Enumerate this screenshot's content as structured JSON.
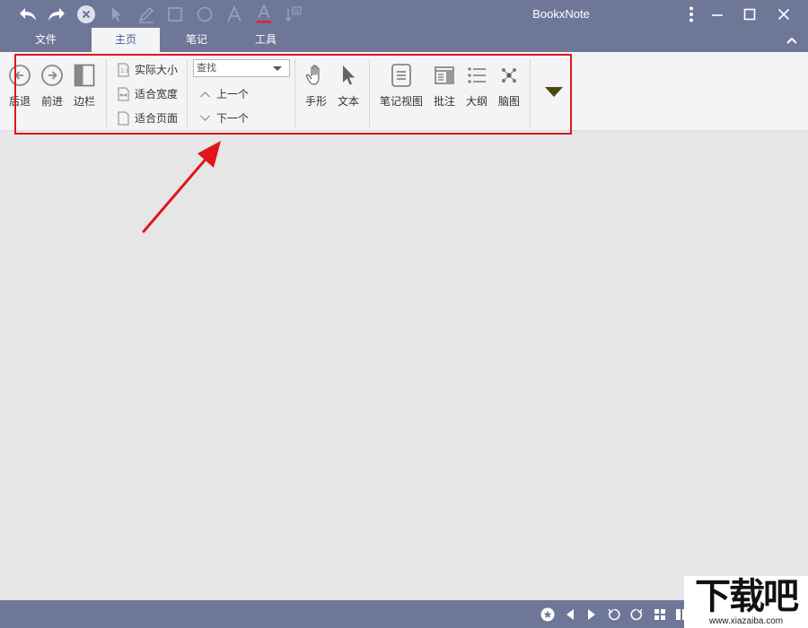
{
  "window": {
    "title": "BookxNote"
  },
  "menu": {
    "tabs": [
      {
        "label": "文件"
      },
      {
        "label": "主页"
      },
      {
        "label": "笔记"
      },
      {
        "label": "工具"
      }
    ],
    "active_tab": "主页"
  },
  "ribbon": {
    "nav": {
      "back_label": "后退",
      "forward_label": "前进",
      "sidebar_label": "边栏"
    },
    "zoom": {
      "actual_size_label": "实际大小",
      "fit_width_label": "适合宽度",
      "fit_page_label": "适合页面"
    },
    "find": {
      "search_value": "查找",
      "prev_label": "上一个",
      "next_label": "下一个"
    },
    "tools": {
      "hand_label": "手形",
      "text_label": "文本"
    },
    "views": {
      "note_view_label": "笔记视图",
      "annotate_label": "批注",
      "outline_label": "大纲",
      "mindmap_label": "脑图"
    }
  },
  "watermark": {
    "main": "下载吧",
    "sub": "www.xiazaiba.com"
  },
  "colors": {
    "chrome": "#6f7798",
    "ribbon_bg": "#f4f4f6",
    "canvas_bg": "#e6e6e6",
    "annotation_red": "#e0161d",
    "more_arrow": "#4a4a10"
  }
}
